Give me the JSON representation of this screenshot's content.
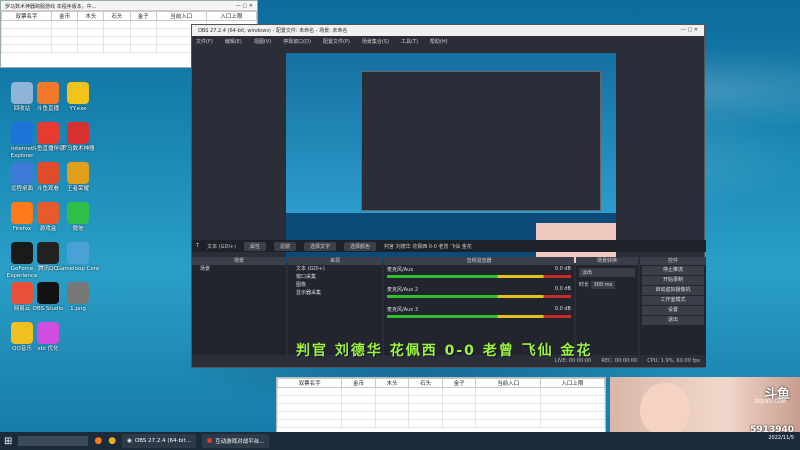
{
  "mini_window": {
    "title": "罗马数术神器跨服游戏 本程序版本，中...",
    "headers": [
      "双票名字",
      "金币",
      "木头",
      "石头",
      "金子",
      "当前入口",
      "入口上限"
    ]
  },
  "desktop_icons": [
    {
      "label": "回收站",
      "color": "#8fb4d8"
    },
    {
      "label": "斗鱼直播",
      "color": "#f2792a"
    },
    {
      "label": "YY.exe",
      "color": "#f2c31a"
    },
    {
      "label": "Internet Explorer",
      "color": "#1e73d6"
    },
    {
      "label": "斗鱼直播伴侣",
      "color": "#e83a2e"
    },
    {
      "label": "罗马数术神器",
      "color": "#d83030"
    },
    {
      "label": "远程桌面",
      "color": "#3c7ad6"
    },
    {
      "label": "斗鱼观看",
      "color": "#e04b2b"
    },
    {
      "label": "王者荣耀",
      "color": "#e0a01c"
    },
    {
      "label": "Firefox",
      "color": "#ff7a1a"
    },
    {
      "label": "游戏盒",
      "color": "#e85a2b"
    },
    {
      "label": "微信",
      "color": "#2fbf4a"
    },
    {
      "label": "GeForce Experience",
      "color": "#1a1a1a"
    },
    {
      "label": "腾讯QQ",
      "color": "#222"
    },
    {
      "label": "Gameloop Core",
      "color": "#4aa1d8"
    },
    {
      "label": "网易云",
      "color": "#e8503a"
    },
    {
      "label": "OBS Studio",
      "color": "#111"
    },
    {
      "label": "1.png",
      "color": "#777"
    },
    {
      "label": "QQ音乐",
      "color": "#f0c020"
    },
    {
      "label": "xbl 优化",
      "color": "#d14de0"
    }
  ],
  "obs": {
    "title": "OBS 27.2.4 (64-bit, windows) - 配置文件: 未命名 - 场景: 未命名",
    "menu": [
      "文件(F)",
      "编辑(E)",
      "视图(V)",
      "停靠窗口(D)",
      "配置文件(P)",
      "场景集合(S)",
      "工具(T)",
      "帮助(H)"
    ],
    "preview_source": "文本 (GDI+)",
    "status_buttons": [
      "属性",
      "滤镜",
      "选择文字",
      "选择颜色"
    ],
    "status_text": "判官 刘德华 花佩西 0-0 老曾 飞仙 金花",
    "panels": [
      "场景",
      "来源",
      "音频混音器",
      "场景转换",
      "控件"
    ],
    "scenes": [
      "场景"
    ],
    "sources": [
      "文本 (GDI+)",
      "窗口采集",
      "图像",
      "显示器采集"
    ],
    "mixer": [
      {
        "name": "麦克风/Aux",
        "db": "0.0 dB"
      },
      {
        "name": "麦克风/Aux 2",
        "db": "0.0 dB"
      },
      {
        "name": "麦克风/Aux 3",
        "db": "0.0 dB"
      }
    ],
    "transition": {
      "type": "淡出",
      "duration_label": "时长",
      "duration": "300 ms"
    },
    "controls": [
      "停止推流",
      "开始录制",
      "启动虚拟摄像机",
      "工作室模式",
      "设置",
      "退出"
    ],
    "footer": [
      "LIVE: 00:00:00",
      "REC: 00:00:00",
      "CPU: 1.9%, 60.00 fps"
    ]
  },
  "caption": "判官 刘德华 花佩西 0-0 老曾 飞仙 金花",
  "sheet": {
    "headers": [
      "双票名字",
      "金币",
      "木头",
      "石头",
      "金子",
      "当前入口",
      "入口上限"
    ]
  },
  "cam": {
    "logo": "斗鱼",
    "logo_sub": "DOUYU.COM",
    "room_id": "5913940",
    "date": "2022/11/5"
  },
  "taskbar": {
    "items": [
      "OBS 27.2.4 (64-bit...",
      "互动游戏对战平台..."
    ],
    "clock_date": "2022/11/5"
  }
}
